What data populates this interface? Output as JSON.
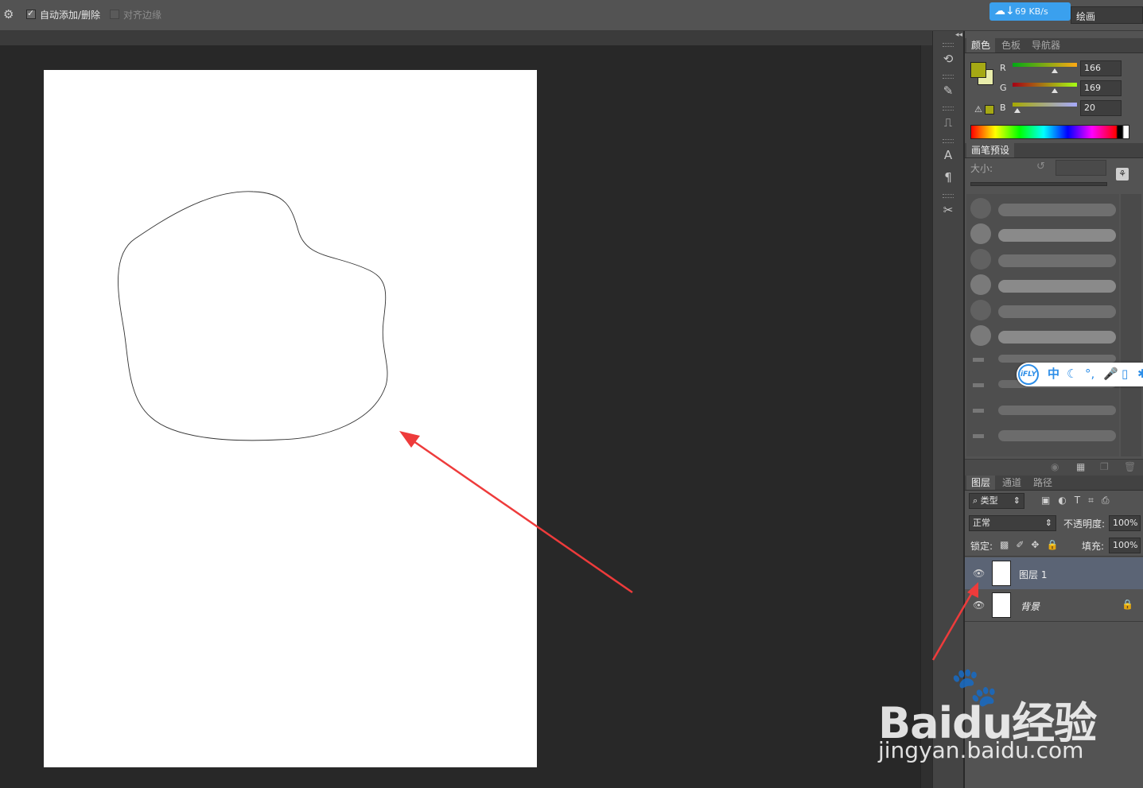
{
  "options_bar": {
    "auto_add_delete_label": "自动添加/删除",
    "align_edges_label": "对齐边缘",
    "gear_icon": "gear-icon"
  },
  "download_speed": {
    "value": "69 KB/s"
  },
  "workspace": {
    "label": "绘画"
  },
  "color_panel": {
    "tabs": [
      "颜色",
      "色板",
      "导航器"
    ],
    "foreground_color": "#a6a914",
    "background_color": "#e8ecaa",
    "channels": [
      {
        "label": "R",
        "value": "166",
        "fraction": 0.65
      },
      {
        "label": "G",
        "value": "169",
        "fraction": 0.66
      },
      {
        "label": "B",
        "value": "20",
        "fraction": 0.08
      }
    ]
  },
  "brush_panel": {
    "tab": "画笔预设",
    "size_label": "大小:"
  },
  "layers_panel": {
    "tabs": [
      "图层",
      "通道",
      "路径"
    ],
    "filter_kind": "类型",
    "blend_mode": "正常",
    "opacity_label": "不透明度:",
    "opacity_value": "100%",
    "lock_label": "锁定:",
    "fill_label": "填充:",
    "fill_value": "100%",
    "layers": [
      {
        "name": "图层 1",
        "selected": true
      },
      {
        "name": "背景",
        "selected": false
      }
    ]
  },
  "ifly": {
    "logo": "iFLY",
    "mode": "中"
  },
  "watermark": {
    "brand": "Baidu经验",
    "url": "jingyan.baidu.com"
  }
}
